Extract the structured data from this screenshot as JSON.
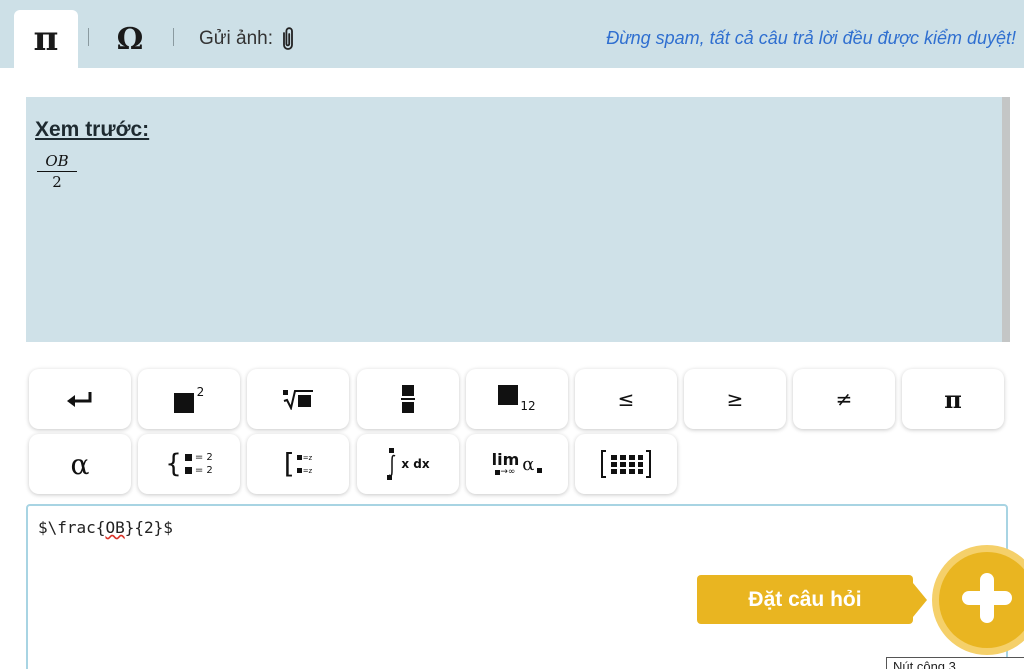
{
  "toolbar": {
    "tab_math": "π",
    "tab_symbols": "Ω",
    "upload_label": "Gửi ảnh:",
    "upload_icon": "paperclip-icon",
    "notice": "Đừng spam, tất cả câu trả lời đều được kiểm duyệt!"
  },
  "preview": {
    "title": "Xem trước:",
    "numerator": "OB",
    "denominator": "2"
  },
  "keypad": {
    "row1": [
      {
        "name": "enter-key",
        "icon": "return-arrow-icon"
      },
      {
        "name": "superscript-key",
        "icon": "superscript-icon",
        "sup": "2"
      },
      {
        "name": "nth-root-key",
        "icon": "nth-root-icon"
      },
      {
        "name": "fraction-key",
        "icon": "fraction-icon"
      },
      {
        "name": "subscript-key",
        "icon": "subscript-icon",
        "sub": "12"
      },
      {
        "name": "less-equal-key",
        "label": "≤"
      },
      {
        "name": "greater-equal-key",
        "label": "≥"
      },
      {
        "name": "not-equal-key",
        "label": "≠"
      },
      {
        "name": "pi-key",
        "label": "π"
      }
    ],
    "row2": [
      {
        "name": "alpha-key",
        "label": "α"
      },
      {
        "name": "equation-system-key",
        "icon": "equation-system-icon",
        "text": "= 2"
      },
      {
        "name": "equation-combination-key",
        "icon": "bracket-system-icon",
        "text": "=z"
      },
      {
        "name": "integral-key",
        "icon": "integral-icon",
        "text": "x dx"
      },
      {
        "name": "limit-key",
        "icon": "limit-icon",
        "lim": "lim",
        "under": "→∞",
        "alpha": "α"
      },
      {
        "name": "matrix-key",
        "icon": "matrix-icon"
      }
    ]
  },
  "editor": {
    "prefix": "$\\frac{",
    "misspelled": "OB",
    "suffix": "}{2}$"
  },
  "ask": {
    "label": "Đặt câu hỏi",
    "icon": "plus-icon"
  },
  "tooltip": {
    "text": "Nút cộng 3..."
  },
  "colors": {
    "toolbar_bg": "#cde0e7",
    "preview_bg": "#cfe1e8",
    "notice": "#2f6fd0",
    "accent": "#e9b521"
  }
}
